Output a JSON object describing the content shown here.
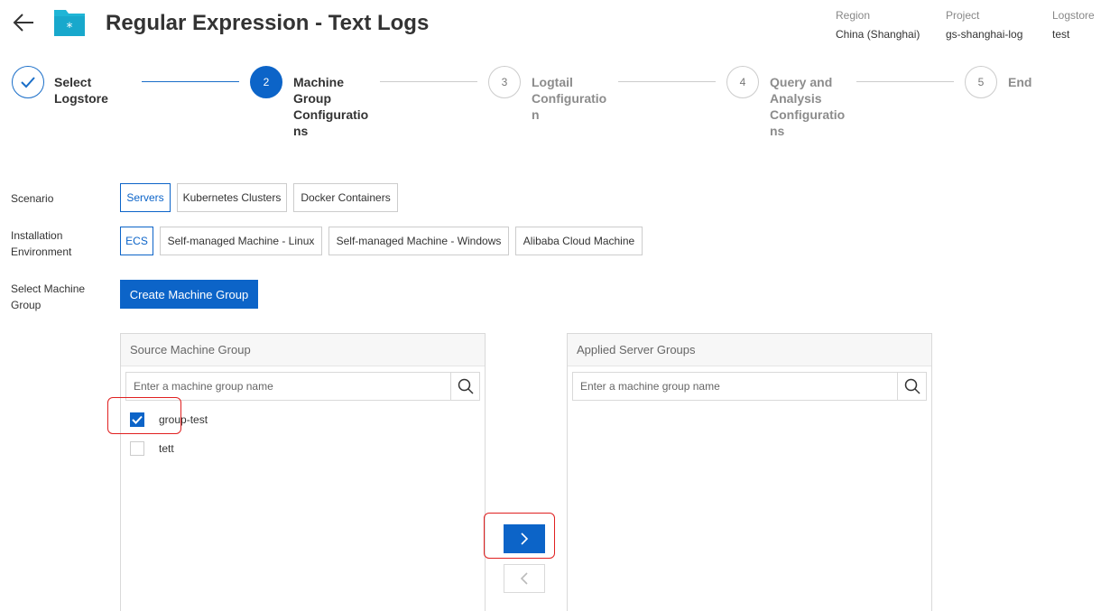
{
  "header": {
    "back_icon": "arrow-left-icon",
    "logo_icon": "logstore-folder-icon",
    "title": "Regular Expression - Text Logs",
    "meta": [
      {
        "label": "Region",
        "value": "China (Shanghai)"
      },
      {
        "label": "Project",
        "value": "gs-shanghai-log"
      },
      {
        "label": "Logstore",
        "value": "test"
      }
    ]
  },
  "steps": [
    {
      "number": "",
      "state": "done",
      "lines": [
        "Select",
        "Logstore"
      ]
    },
    {
      "number": "2",
      "state": "active",
      "lines": [
        "Machine",
        "Group",
        "Configuratio",
        "ns"
      ]
    },
    {
      "number": "3",
      "state": "pending",
      "lines": [
        "Logtail",
        "Configuratio",
        "n"
      ]
    },
    {
      "number": "4",
      "state": "pending",
      "lines": [
        "Query and",
        "Analysis",
        "Configuratio",
        "ns"
      ]
    },
    {
      "number": "5",
      "state": "pending",
      "lines": [
        "End"
      ]
    }
  ],
  "form": {
    "scenario_label": "Scenario",
    "scenario_options": [
      "Servers",
      "Kubernetes Clusters",
      "Docker Containers"
    ],
    "scenario_selected": "Servers",
    "install_label_1": "Installation",
    "install_label_2": "Environment",
    "install_options": [
      "ECS",
      "Self-managed Machine - Linux",
      "Self-managed Machine - Windows",
      "Alibaba Cloud Machine"
    ],
    "install_selected": "ECS",
    "machine_label_1": "Select Machine",
    "machine_label_2": "Group",
    "create_button": "Create Machine Group"
  },
  "transfer": {
    "source": {
      "title": "Source Machine Group",
      "placeholder": "Enter a machine group name",
      "items": [
        {
          "name": "group-test",
          "checked": true
        },
        {
          "name": "tett",
          "checked": false
        }
      ]
    },
    "target": {
      "title": "Applied Server Groups",
      "placeholder": "Enter a machine group name",
      "items": []
    },
    "move_right_icon": "chevron-right-icon",
    "move_left_icon": "chevron-left-icon"
  },
  "colors": {
    "primary": "#0c64c8",
    "highlight": "#e02020"
  }
}
